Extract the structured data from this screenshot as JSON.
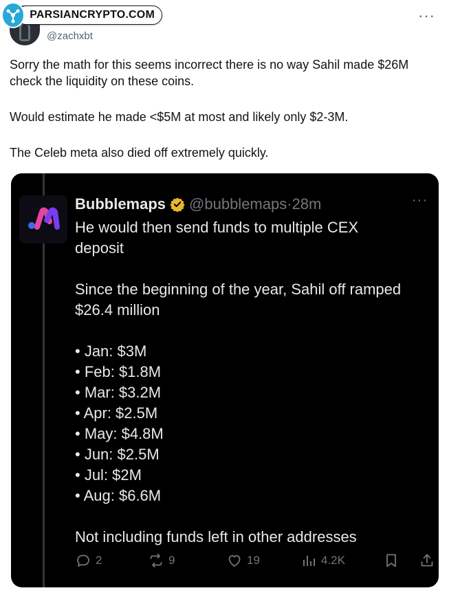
{
  "watermark": {
    "text": "PARSIANCRYPTO.COM"
  },
  "tweet": {
    "handle": "@zachxbt",
    "lines": [
      "Sorry the math for this seems incorrect there is no way Sahil made $26M",
      "check the liquidity on these coins.",
      "",
      "Would estimate he made <$5M at most and likely only $2-3M.",
      "",
      "The Celeb meta also died off extremely quickly."
    ]
  },
  "quote": {
    "name": "Bubblemaps",
    "handle": "@bubblemaps",
    "separator": "·",
    "time": "28m",
    "lines": [
      "He would then send funds to multiple CEX",
      "deposit",
      "",
      "Since the beginning of the year, Sahil off ramped",
      "$26.4 million",
      "",
      "• Jan: $3M",
      "• Feb: $1.8M",
      "• Mar: $3.2M",
      "• Apr: $2.5M",
      "• May: $4.8M",
      "• Jun: $2.5M",
      "• Jul: $2M",
      "• Aug: $6.6M",
      "",
      "Not including funds left in other addresses"
    ],
    "stats": {
      "replies": "2",
      "reposts": "9",
      "likes": "19",
      "views": "4.2K"
    }
  },
  "colors": {
    "verified": "#e8b62d",
    "logo_blue": "#3b6cf0",
    "logo_pink": "#e0479e",
    "logo_purple": "#7a3cf0"
  }
}
